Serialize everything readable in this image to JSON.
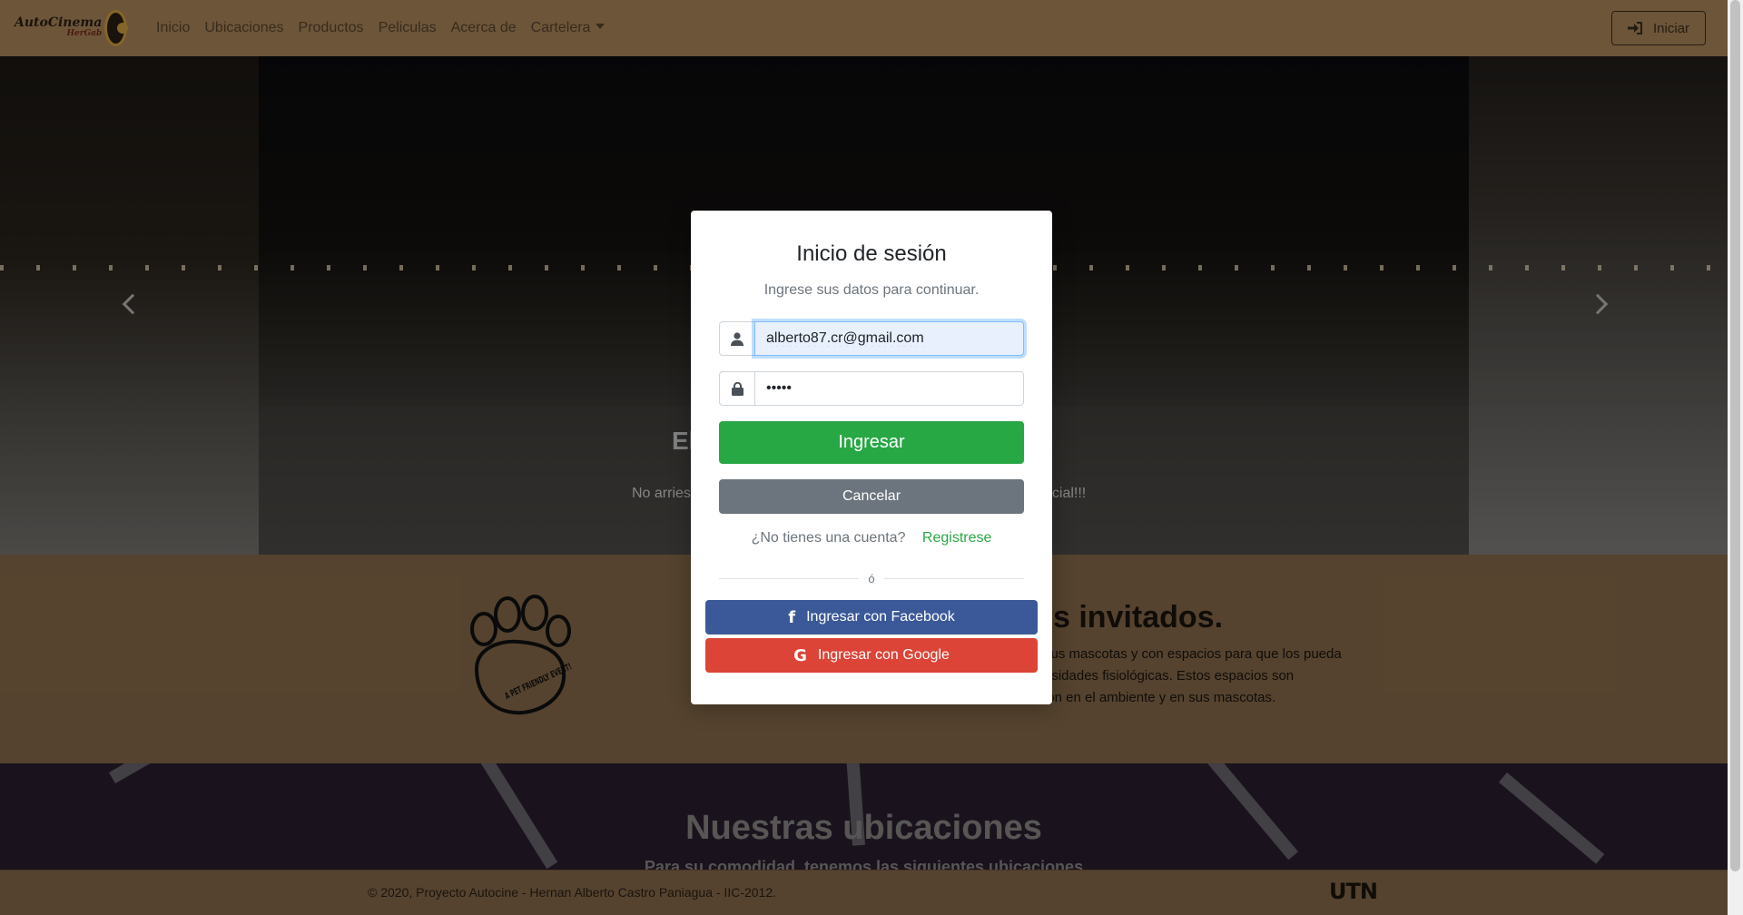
{
  "brand": {
    "name": "AutoCinema",
    "tagline": "HerGab"
  },
  "nav": {
    "links": [
      {
        "label": "Inicio"
      },
      {
        "label": "Ubicaciones"
      },
      {
        "label": "Productos"
      },
      {
        "label": "Peliculas"
      },
      {
        "label": "Acerca de"
      },
      {
        "label": "Cartelera"
      }
    ],
    "login_label": "Iniciar"
  },
  "hero": {
    "title_fragment": "El",
    "sub_left_fragment": "No arries",
    "sub_right_fragment": "ocial!!!"
  },
  "pets": {
    "title_fragment": "s invitados.",
    "text_lines": [
      "sus mascotas y con espacios para que los pueda",
      "esidades fisiológicas. Estos espacios son",
      "ión en el ambiente y en sus mascotas."
    ],
    "badge_text": "A PET FRIENDLY EVENT!"
  },
  "locations": {
    "title": "Nuestras ubicaciones",
    "subtitle": "Para su comodidad, tenemos las siguientes ubicaciones"
  },
  "footer": {
    "text": "© 2020, Proyecto Autocine - Hernan Alberto Castro Paniagua - IIC-2012.",
    "logo": "UTN"
  },
  "modal": {
    "title": "Inicio de sesión",
    "subtitle": "Ingrese sus datos para continuar.",
    "email_value": "alberto87.cr@gmail.com",
    "password_value": "•••••",
    "submit_label": "Ingresar",
    "cancel_label": "Cancelar",
    "no_account_text": "¿No tienes una cuenta?",
    "register_label": "Registrese",
    "divider_text": "ó",
    "facebook_label": "Ingresar con Facebook",
    "google_label": "Ingresar con Google",
    "facebook_icon_glyph": "f",
    "google_icon_glyph": "G"
  },
  "colors": {
    "success": "#28a745",
    "secondary": "#6c757d",
    "facebook": "#3b5998",
    "google": "#db4437",
    "navbar": "#b08a5c"
  }
}
